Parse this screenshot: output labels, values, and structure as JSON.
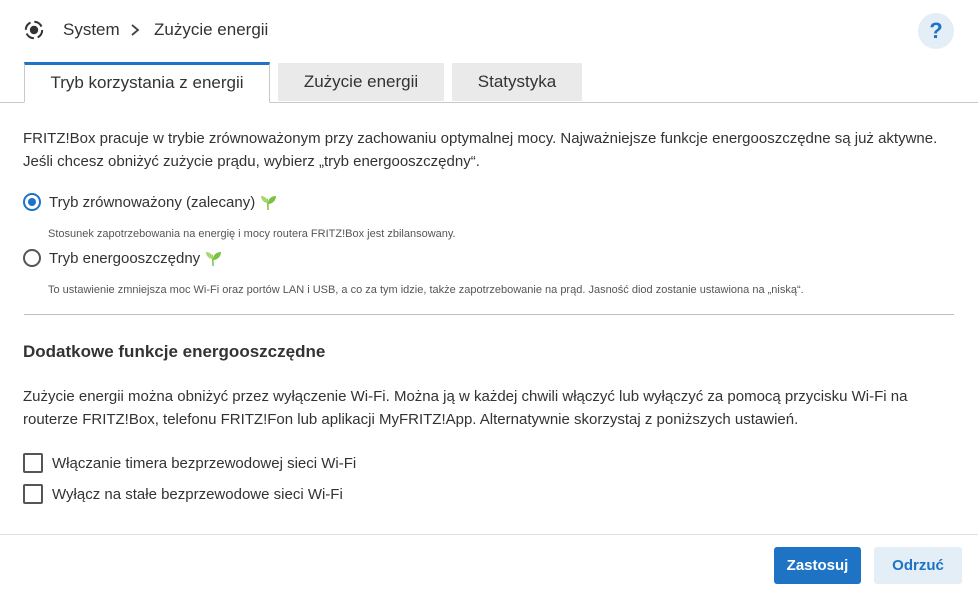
{
  "breadcrumb": {
    "icon": "system-icon",
    "system_label": "System",
    "separator_icon": "chevron-right-icon",
    "current_label": "Zużycie energii"
  },
  "help": {
    "label": "?"
  },
  "tabs": [
    {
      "label": "Tryb korzystania z energii",
      "active": true
    },
    {
      "label": "Zużycie energii",
      "active": false
    },
    {
      "label": "Statystyka",
      "active": false
    }
  ],
  "intro": "FRITZ!Box pracuje w trybie zrównoważonym przy zachowaniu optymalnej mocy. Najważniejsze funkcje energooszczędne są już aktywne. Jeśli chcesz obniżyć zużycie prądu, wybierz „tryb energooszczędny“.",
  "modes": [
    {
      "label": "Tryb zrównoważony (zalecany)",
      "selected": true,
      "icon": "leaf-icon",
      "description": "Stosunek zapotrzebowania na energię i mocy routera FRITZ!Box jest zbilansowany."
    },
    {
      "label": "Tryb energooszczędny",
      "selected": false,
      "icon": "leaf-icon",
      "description": "To ustawienie zmniejsza moc Wi-Fi oraz portów LAN i USB, a co za tym idzie, także zapotrzebowanie na prąd. Jasność diod zostanie ustawiona na „niską“."
    }
  ],
  "extra": {
    "title": "Dodatkowe funkcje energooszczędne",
    "text": "Zużycie energii można obniżyć przez wyłączenie Wi-Fi. Można ją w każdej chwili włączyć lub wyłączyć za pomocą przycisku Wi-Fi na routerze FRITZ!Box, telefonu FRITZ!Fon lub aplikacji MyFRITZ!App. Alternatywnie skorzystaj z poniższych ustawień.",
    "options": [
      {
        "label": "Włączanie timera bezprzewodowej sieci Wi-Fi",
        "checked": false
      },
      {
        "label": "Wyłącz na stałe bezprzewodowe sieci Wi-Fi",
        "checked": false
      }
    ]
  },
  "buttons": {
    "apply": "Zastosuj",
    "discard": "Odrzuć"
  },
  "colors": {
    "accent": "#1e73c4",
    "leaf": "#7cc242",
    "secondary_button_bg": "#e4eef7"
  }
}
